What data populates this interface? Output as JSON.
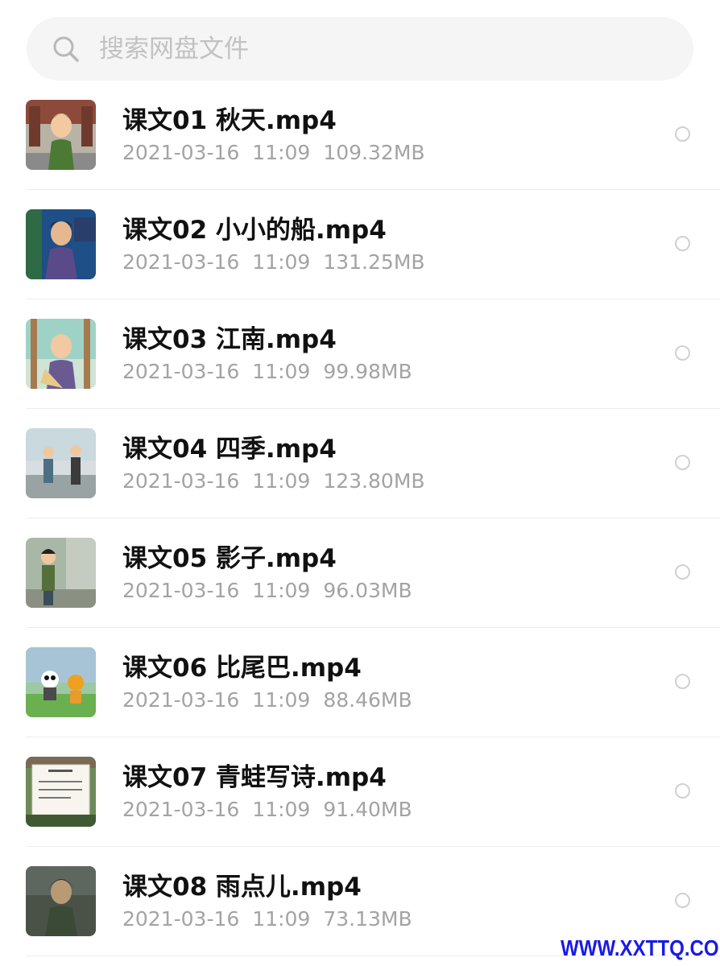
{
  "search": {
    "placeholder": "搜索网盘文件",
    "value": ""
  },
  "files": [
    {
      "name": "课文01 秋天.mp4",
      "date": "2021-03-16",
      "time": "11:09",
      "size": "109.32MB"
    },
    {
      "name": "课文02 小小的船.mp4",
      "date": "2021-03-16",
      "time": "11:09",
      "size": "131.25MB"
    },
    {
      "name": "课文03 江南.mp4",
      "date": "2021-03-16",
      "time": "11:09",
      "size": "99.98MB"
    },
    {
      "name": "课文04 四季.mp4",
      "date": "2021-03-16",
      "time": "11:09",
      "size": "123.80MB"
    },
    {
      "name": "课文05 影子.mp4",
      "date": "2021-03-16",
      "time": "11:09",
      "size": "96.03MB"
    },
    {
      "name": "课文06 比尾巴.mp4",
      "date": "2021-03-16",
      "time": "11:09",
      "size": "88.46MB"
    },
    {
      "name": "课文07 青蛙写诗.mp4",
      "date": "2021-03-16",
      "time": "11:09",
      "size": "91.40MB"
    },
    {
      "name": "课文08 雨点儿.mp4",
      "date": "2021-03-16",
      "time": "11:09",
      "size": "73.13MB"
    }
  ],
  "watermark": "WWW.XXTTQ.COM",
  "colors": {
    "search_bg": "#f5f5f5",
    "placeholder": "#c2c2c2",
    "file_name": "#111111",
    "meta": "#a3a3a3",
    "divider": "#ececec",
    "watermark": "#1a1ae6"
  }
}
